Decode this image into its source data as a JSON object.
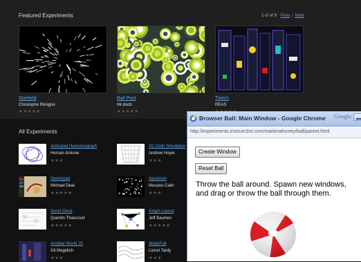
{
  "site": {
    "featured_title": "Featured Experiments",
    "pager": {
      "range": "1-3 of 9",
      "prev": "Prev",
      "separator": "|",
      "next": "Next"
    },
    "featured": [
      {
        "name": "Starfield",
        "author": "Christophe Résigné",
        "stars": "★★★★★"
      },
      {
        "name": "Ball Pool",
        "author": "Mr.doob",
        "stars": "★★★★★"
      },
      {
        "name": "Twitch",
        "author": "REAS",
        "stars": "★★★★★"
      }
    ],
    "all_title": "All Experiments",
    "experiments": [
      {
        "name": "Animated Harmonograph",
        "author": "Hernan Amiune",
        "stars": "★★★"
      },
      {
        "name": "2D Cloth Simulation",
        "author": "Andrew Hoyer",
        "stars": "★★★"
      },
      {
        "name": "Sketchpad",
        "author": "Michael Deal",
        "stars": "★★★★★"
      },
      {
        "name": "Aquarium",
        "author": "Mocanu Calin",
        "stars": "★★★"
      },
      {
        "name": "Scroll Clock",
        "author": "Quentin Thaucourt",
        "stars": "★★★★★"
      },
      {
        "name": "Graph Layout",
        "author": "Jeff Baumes",
        "stars": "★★★★★"
      },
      {
        "name": "Another World JS",
        "author": "Gil Megidish",
        "stars": "★★★"
      },
      {
        "name": "WaterFall",
        "author": "Lionel Tardy",
        "stars": "★★★"
      }
    ]
  },
  "popup": {
    "title": "Browser Ball: Main Window - Google Chrome",
    "brand": "Google",
    "url": "http://experiments.instrum3nt.com/markmahoney/ball/parent.html",
    "create_button": "Create Window",
    "reset_button": "Reset Ball",
    "instructions": "Throw the ball around. Spawn new windows, and drag or throw the ball through them."
  },
  "colors": {
    "link": "#5aa7e8",
    "page_bg": "#121212",
    "ball_red": "#e0141d"
  },
  "icons": [
    "chrome-app-icon",
    "minimize-icon",
    "beach-ball"
  ]
}
